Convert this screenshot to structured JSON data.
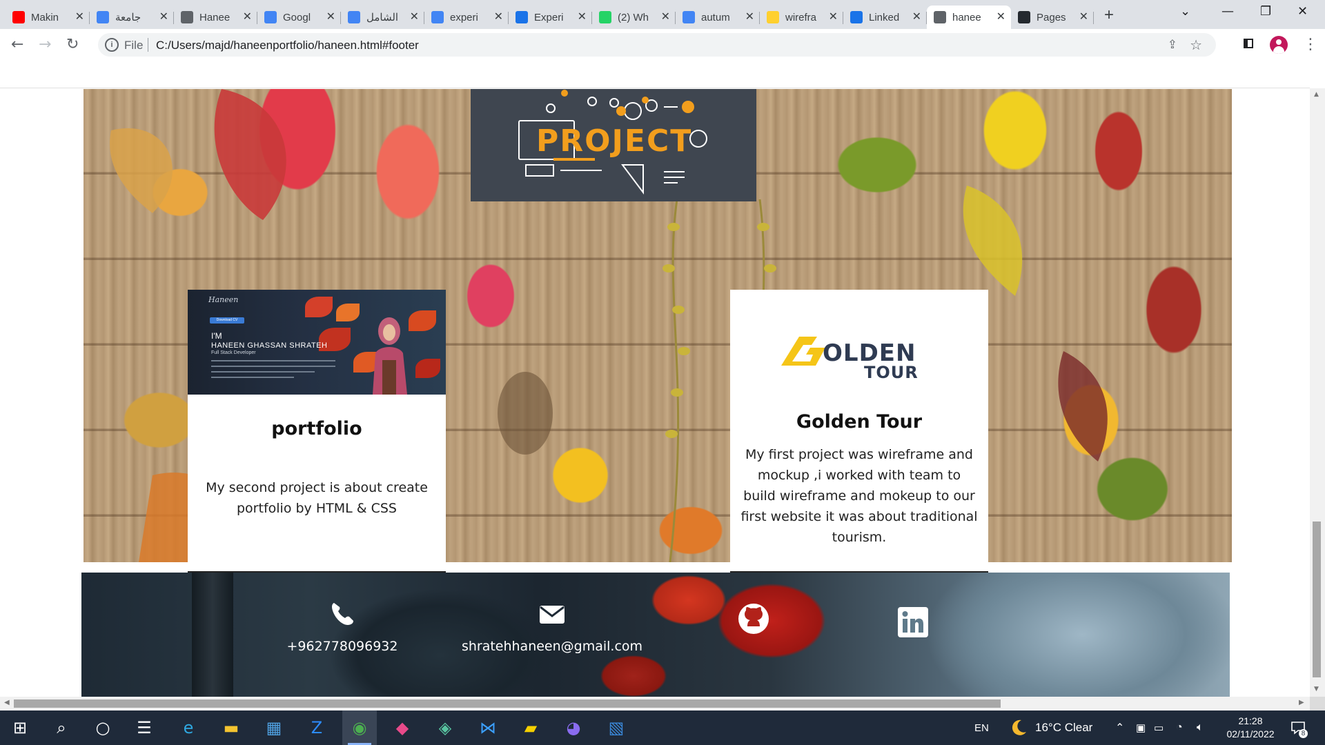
{
  "browser": {
    "tabs": [
      {
        "label": "Makin",
        "icon": "youtube-icon",
        "color": "#ff0000"
      },
      {
        "label": "جامعة",
        "icon": "google-icon",
        "color": "#4285f4"
      },
      {
        "label": "Hanee",
        "icon": "globe-icon",
        "color": "#5f6368"
      },
      {
        "label": "Googl",
        "icon": "google-translate-icon",
        "color": "#4285f4"
      },
      {
        "label": "الشامل",
        "icon": "google-icon",
        "color": "#4285f4"
      },
      {
        "label": "experi",
        "icon": "google-icon",
        "color": "#4285f4"
      },
      {
        "label": "Experi",
        "icon": "figma-gear-icon",
        "color": "#1a73e8"
      },
      {
        "label": "(2) Wh",
        "icon": "whatsapp-icon",
        "color": "#25d366"
      },
      {
        "label": "autum",
        "icon": "google-icon",
        "color": "#4285f4"
      },
      {
        "label": "wirefra",
        "icon": "miro-icon",
        "color": "#ffd02f"
      },
      {
        "label": "Linked",
        "icon": "flag-icon",
        "color": "#1a73e8"
      },
      {
        "label": "hanee",
        "icon": "globe-icon",
        "color": "#5f6368",
        "active": true
      },
      {
        "label": "Pages",
        "icon": "github-icon",
        "color": "#24292f"
      }
    ],
    "address": {
      "scheme_label": "File",
      "url": "C:/Users/majd/haneenportfolio/haneen.html#footer"
    }
  },
  "page": {
    "projects": [
      {
        "title": "portfolio",
        "description": "My second project is about create portfolio by HTML & CSS",
        "thumbnail": {
          "logo": "Haneen",
          "button": "Download CV",
          "intro": "I'M",
          "name": "HANEEN GHASSAN SHRATEH",
          "role": "Full Stack Developer"
        }
      },
      {
        "title": "Golden Tour",
        "description": "My first project was wireframe and mockup ,i worked with team to build wireframe and mokeup to our first website it was about traditional tourism.",
        "logo": {
          "word1": "OLDEN",
          "word2": "TOUR",
          "letter": "G"
        }
      }
    ],
    "project_logo_text": "PROJECT",
    "footer": {
      "phone": "+962778096932",
      "email": "shratehhaneen@gmail.com",
      "icons": [
        "phone-icon",
        "email-icon",
        "github-icon",
        "linkedin-icon"
      ]
    }
  },
  "taskbar": {
    "language": "EN",
    "weather": "16°C  Clear",
    "time": "21:28",
    "date": "02/11/2022",
    "notifications": "8",
    "apps": [
      "start-icon",
      "search-icon",
      "cortana-icon",
      "task-view-icon",
      "edge-icon",
      "file-explorer-icon",
      "store-icon",
      "zoom-icon",
      "chrome-icon",
      "drop-icon",
      "git-kraken-icon",
      "vscode-icon",
      "sticky-notes-icon",
      "discord-icon",
      "photos-icon"
    ]
  },
  "colors": {
    "accent": "#f29e1d",
    "card_border": "#222222",
    "logo_bg": "#3f4650",
    "taskbar": "#1f2a3a"
  }
}
